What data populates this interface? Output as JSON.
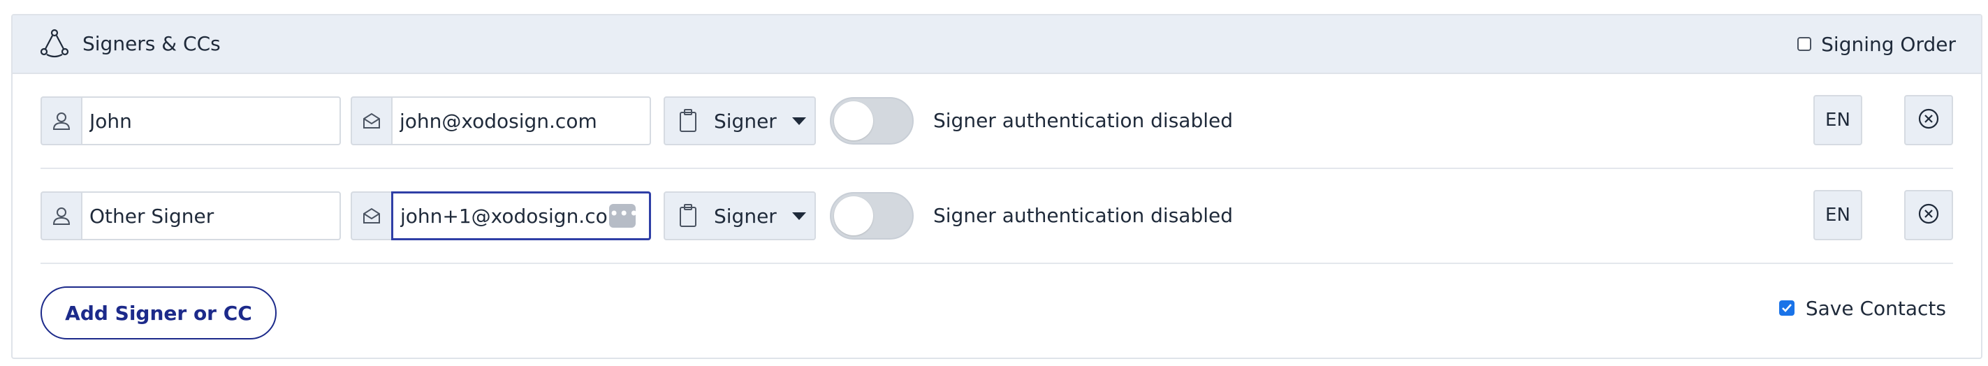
{
  "header": {
    "title": "Signers & CCs",
    "signing_order_label": "Signing Order",
    "signing_order_checked": false
  },
  "signers": [
    {
      "name": "John",
      "email": "john@xodosign.com",
      "role": "Signer",
      "auth_enabled": false,
      "auth_text": "Signer authentication disabled",
      "language": "EN"
    },
    {
      "name": "Other Signer",
      "email": "john+1@xodosign.com",
      "role": "Signer",
      "auth_enabled": false,
      "auth_text": "Signer authentication disabled",
      "language": "EN",
      "email_focused": true
    }
  ],
  "footer": {
    "add_button_label": "Add Signer or CC",
    "save_contacts_label": "Save Contacts",
    "save_contacts_checked": true
  },
  "icons": {
    "header": "signers-network-icon",
    "name_field": "person-icon",
    "email_field": "envelope-icon",
    "role": "clipboard-icon",
    "remove": "close-circle-icon"
  },
  "colors": {
    "accent": "#1c2a8a",
    "checkbox": "#1a73e8",
    "header_bg": "#e9eef5"
  }
}
